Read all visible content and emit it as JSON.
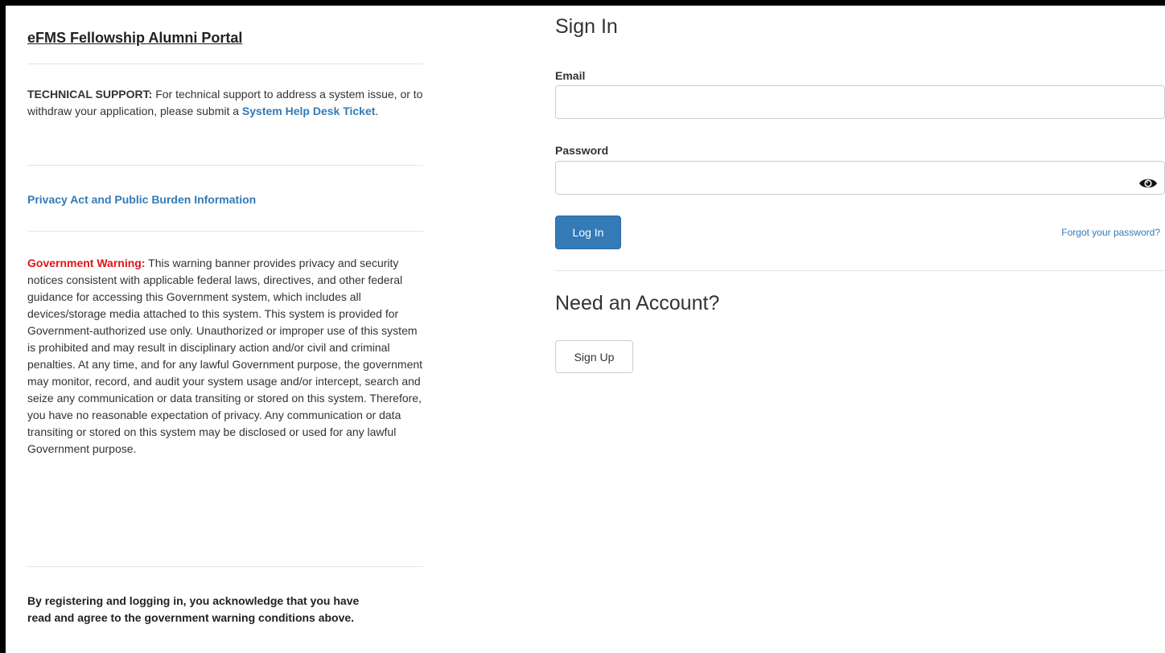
{
  "left": {
    "portal_title": "eFMS Fellowship Alumni Portal",
    "tech_support": {
      "label": "TECHNICAL SUPPORT:",
      "text": " For technical support to address a system issue, or to withdraw your application, please submit a ",
      "link": "System Help Desk Ticket",
      "end": "."
    },
    "privacy_link": "Privacy Act and Public Burden Information",
    "warning": {
      "label": "Government Warning:",
      "text": " This warning banner provides privacy and security notices consistent with applicable federal laws, directives, and other federal guidance for accessing this Government system, which includes all devices/storage media attached to this system. This system is provided for Government-authorized use only. Unauthorized or improper use of this system is prohibited and may result in disciplinary action and/or civil and criminal penalties. At any time, and for any lawful Government purpose, the government may monitor, record, and audit your system usage and/or intercept, search and seize any communication or data transiting or stored on this system. Therefore, you have no reasonable expectation of privacy. Any communication or data transiting or stored on this system may be disclosed or used for any lawful Government purpose."
    },
    "acknowledgement": "By registering and logging in, you acknowledge that you have read and agree to the government warning conditions above."
  },
  "signin": {
    "heading": "Sign In",
    "email_label": "Email",
    "email_value": "",
    "password_label": "Password",
    "password_value": "",
    "login_button": "Log In",
    "forgot_link": "Forgot your password?"
  },
  "account": {
    "heading": "Need an Account?",
    "signup_button": "Sign Up"
  },
  "colors": {
    "link": "#337ab7",
    "primary_button": "#337ab7",
    "warning_label": "#e01515"
  },
  "icons": {
    "password_toggle": "eye-icon"
  }
}
